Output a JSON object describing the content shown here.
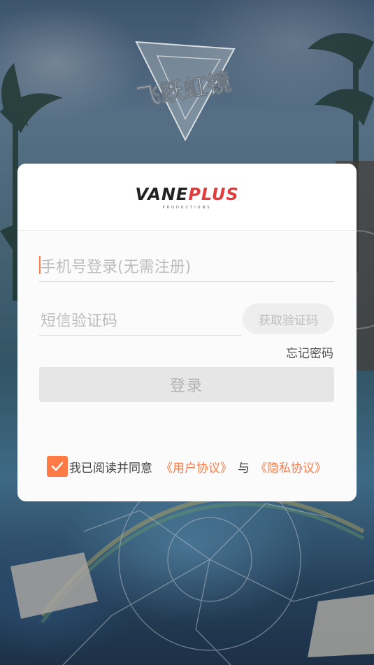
{
  "background": {
    "theme": "anime-tropical-city-shattered-glass"
  },
  "game_logo": {
    "text": "飞跃虹镜"
  },
  "brand": {
    "name_part1": "VANE",
    "name_part2": "PLUS",
    "subtitle": "PRODUCTIONS"
  },
  "form": {
    "phone_placeholder": "手机号登录(无需注册)",
    "sms_placeholder": "短信验证码",
    "get_code_label": "获取验证码",
    "forgot_password_label": "忘记密码",
    "login_label": "登录"
  },
  "agreement": {
    "checked": true,
    "prefix": "我已阅读并同意",
    "user_agreement": "《用户协议》",
    "connector": "与",
    "privacy_policy": "《隐私协议》"
  },
  "colors": {
    "accent": "#ff7a45",
    "card_bg": "#fbfbfb",
    "disabled_button": "#e6e6e6",
    "brand_red": "#e23b3b"
  }
}
